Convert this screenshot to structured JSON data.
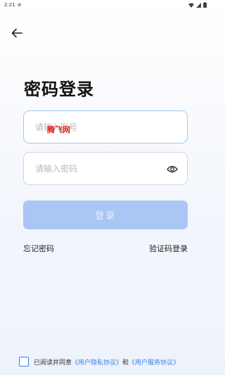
{
  "status_bar": {
    "time": "2:21"
  },
  "title": "密码登录",
  "phone_field": {
    "placeholder": "请输入账号"
  },
  "watermark": "腾飞网",
  "password_field": {
    "placeholder": "请输入密码"
  },
  "login_button": {
    "label": "登录"
  },
  "links": {
    "forgot": "忘记密码",
    "sms_login": "验证码登录"
  },
  "agreement": {
    "prefix": "已阅读并同意",
    "privacy": "《用户隐私协议》",
    "and": "和",
    "service": "《用户服务协议》"
  },
  "colors": {
    "accent": "#3b7be8",
    "button_disabled": "#aac6f4"
  }
}
